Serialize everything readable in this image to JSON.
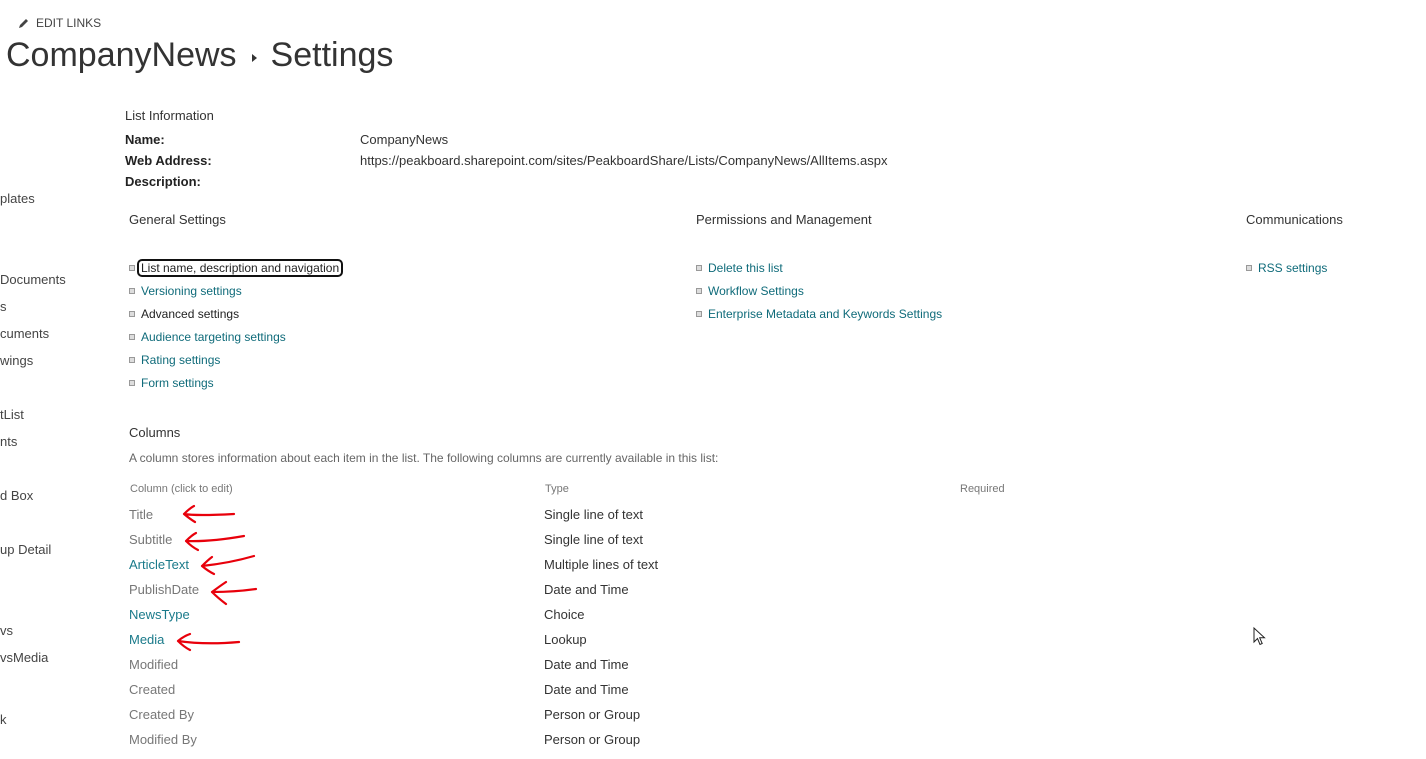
{
  "header": {
    "edit_links": "EDIT LINKS",
    "site": "CompanyNews",
    "page": "Settings"
  },
  "sidebar": {
    "items": [
      "plates",
      "Documents",
      "s",
      "cuments",
      "wings",
      "tList",
      "nts",
      "d Box",
      "up Detail",
      "vs",
      "vsMedia",
      "k"
    ]
  },
  "list_info": {
    "heading": "List Information",
    "name_label": "Name:",
    "name_value": "CompanyNews",
    "web_label": "Web Address:",
    "web_value": "https://peakboard.sharepoint.com/sites/PeakboardShare/Lists/CompanyNews/AllItems.aspx",
    "desc_label": "Description:"
  },
  "general": {
    "heading": "General Settings",
    "links": [
      "List name, description and navigation",
      "Versioning settings",
      "Advanced settings",
      "Audience targeting settings",
      "Rating settings",
      "Form settings"
    ]
  },
  "permissions": {
    "heading": "Permissions and Management",
    "links": [
      "Delete this list",
      "Workflow Settings",
      "Enterprise Metadata and Keywords Settings"
    ]
  },
  "communications": {
    "heading": "Communications",
    "links": [
      "RSS settings"
    ]
  },
  "columns": {
    "heading": "Columns",
    "description": "A column stores information about each item in the list. The following columns are currently available in this list:",
    "headers": [
      "Column (click to edit)",
      "Type",
      "Required"
    ],
    "rows": [
      {
        "name": "Title",
        "type": "Single line of text"
      },
      {
        "name": "Subtitle",
        "type": "Single line of text"
      },
      {
        "name": "ArticleText",
        "type": "Multiple lines of text"
      },
      {
        "name": "PublishDate",
        "type": "Date and Time"
      },
      {
        "name": "NewsType",
        "type": "Choice"
      },
      {
        "name": "Media",
        "type": "Lookup"
      },
      {
        "name": "Modified",
        "type": "Date and Time"
      },
      {
        "name": "Created",
        "type": "Date and Time"
      },
      {
        "name": "Created By",
        "type": "Person or Group"
      },
      {
        "name": "Modified By",
        "type": "Person or Group"
      }
    ]
  },
  "colors": {
    "link": "#0f6b7a",
    "annotation": "#e8000b"
  }
}
